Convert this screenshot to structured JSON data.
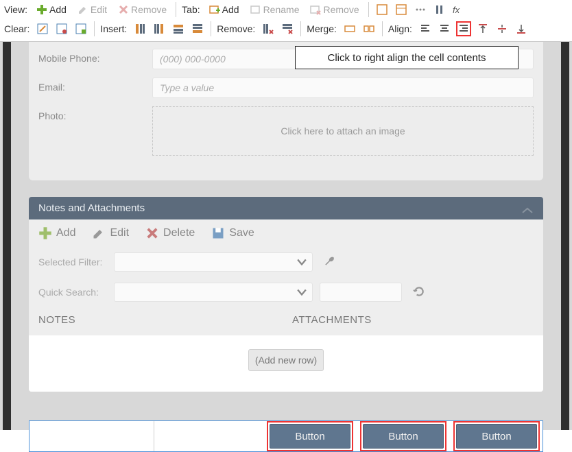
{
  "toolbar": {
    "row1": {
      "view_label": "View:",
      "add": "Add",
      "edit": "Edit",
      "remove": "Remove",
      "tab_label": "Tab:",
      "tab_add": "Add",
      "tab_rename": "Rename",
      "tab_remove": "Remove"
    },
    "row2": {
      "clear_label": "Clear:",
      "insert_label": "Insert:",
      "remove_label": "Remove:",
      "merge_label": "Merge:",
      "align_label": "Align:"
    }
  },
  "tooltip": "Click to right align the cell contents",
  "form": {
    "mobile_label": "Mobile Phone:",
    "mobile_placeholder": "(000) 000-0000",
    "email_label": "Email:",
    "email_placeholder": "Type a value",
    "photo_label": "Photo:",
    "photo_placeholder": "Click here to attach an image"
  },
  "section": {
    "title": "Notes and Attachments",
    "toolbar": {
      "add": "Add",
      "edit": "Edit",
      "delete": "Delete",
      "save": "Save"
    },
    "filter_label": "Selected Filter:",
    "search_label": "Quick Search:",
    "col_notes": "NOTES",
    "col_attach": "ATTACHMENTS",
    "add_row": "(Add new row)"
  },
  "buttons": {
    "label": "Button"
  }
}
